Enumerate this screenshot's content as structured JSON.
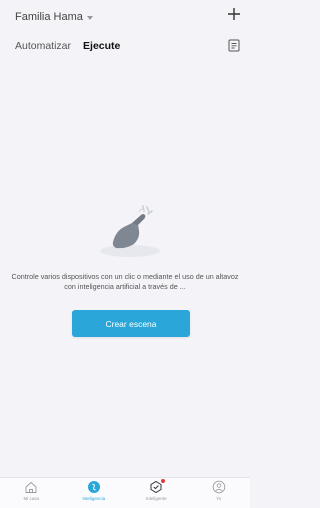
{
  "header": {
    "home_name": "Familia Hama"
  },
  "tabs": [
    {
      "label": "Automatizar",
      "active": false
    },
    {
      "label": "Ejecute",
      "active": true
    }
  ],
  "empty_state": {
    "message": "Controle varios dispositivos con un clic o mediante el uso de un altavoz con inteligencia artificial a través de ...",
    "cta_label": "Crear escena"
  },
  "bottom_nav": [
    {
      "label": "Mi casa",
      "icon": "home-icon",
      "active": false
    },
    {
      "label": "Inteligencia",
      "icon": "intelligence-icon",
      "active": true
    },
    {
      "label": "Inteligente",
      "icon": "smart-icon",
      "active": false,
      "badge": true
    },
    {
      "label": "Yo",
      "icon": "profile-icon",
      "active": false
    }
  ],
  "colors": {
    "accent": "#2aa7d8",
    "badge": "#e23b3b",
    "background": "#f4f4f8"
  }
}
